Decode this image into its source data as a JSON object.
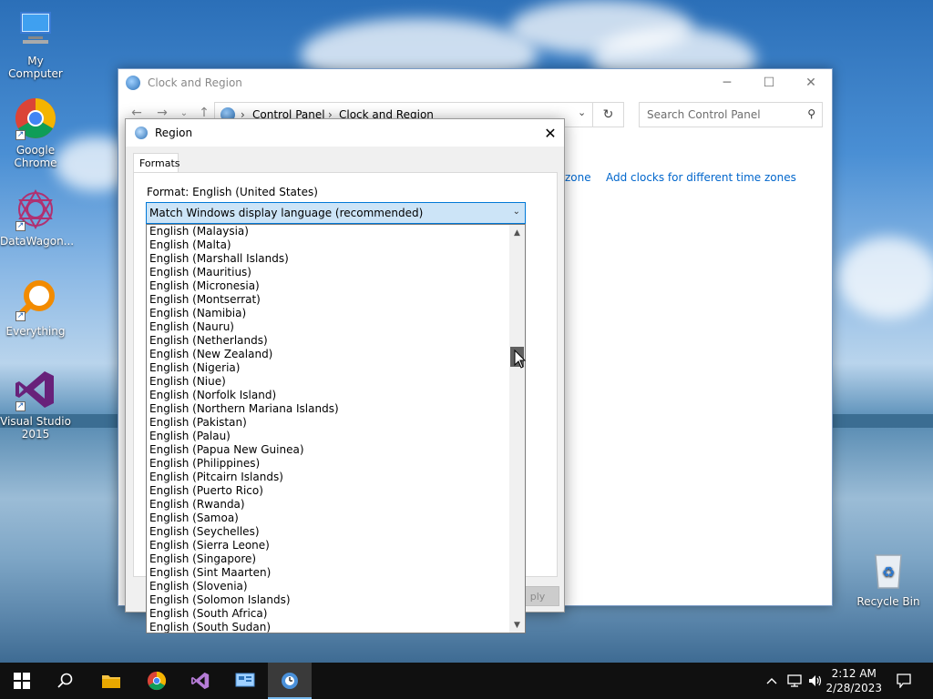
{
  "desktop": {
    "icons": [
      {
        "label": "My Computer"
      },
      {
        "label": "Google Chrome"
      },
      {
        "label": "DataWagon..."
      },
      {
        "label": "Everything"
      },
      {
        "label": "Visual Studio 2015"
      },
      {
        "label": "Recycle Bin"
      }
    ]
  },
  "control_panel": {
    "title": "Clock and Region",
    "breadcrumb": [
      "Control Panel",
      "Clock and Region"
    ],
    "search_placeholder": "Search Control Panel",
    "link_partial": "zone",
    "link_clocks": "Add clocks for different time zones"
  },
  "region_dialog": {
    "title": "Region",
    "tab_formats": "Formats",
    "format_label": "Format: English (United States)",
    "selected": "Match Windows display language (recommended)",
    "apply_partial": "ply",
    "options": [
      "English (Malaysia)",
      "English (Malta)",
      "English (Marshall Islands)",
      "English (Mauritius)",
      "English (Micronesia)",
      "English (Montserrat)",
      "English (Namibia)",
      "English (Nauru)",
      "English (Netherlands)",
      "English (New Zealand)",
      "English (Nigeria)",
      "English (Niue)",
      "English (Norfolk Island)",
      "English (Northern Mariana Islands)",
      "English (Pakistan)",
      "English (Palau)",
      "English (Papua New Guinea)",
      "English (Philippines)",
      "English (Pitcairn Islands)",
      "English (Puerto Rico)",
      "English (Rwanda)",
      "English (Samoa)",
      "English (Seychelles)",
      "English (Sierra Leone)",
      "English (Singapore)",
      "English (Sint Maarten)",
      "English (Slovenia)",
      "English (Solomon Islands)",
      "English (South Africa)",
      "English (South Sudan)"
    ]
  },
  "taskbar": {
    "time": "2:12 AM",
    "date": "2/28/2023"
  }
}
